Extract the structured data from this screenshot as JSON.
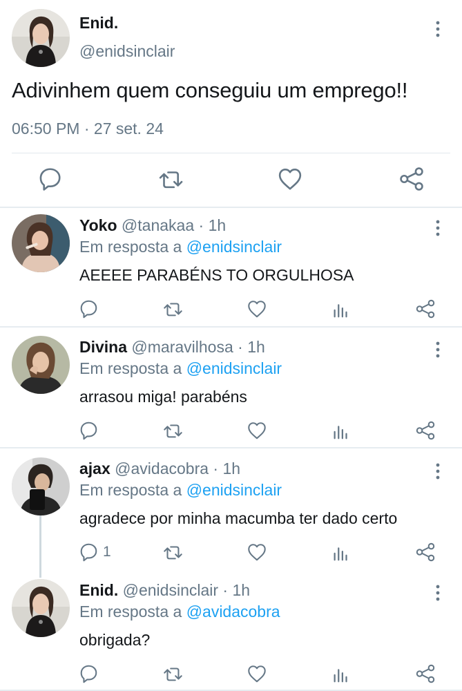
{
  "main": {
    "name": "Enid.",
    "handle": "@enidsinclair",
    "text": "Adivinhem quem conseguiu um emprego!!",
    "time": "06:50 PM",
    "date_sep": " · ",
    "date": "27 set. 24",
    "actions": [
      "reply-icon",
      "retweet-icon",
      "like-icon",
      "share-icon"
    ]
  },
  "replies": [
    {
      "name": "Yoko",
      "handle": "@tanakaa",
      "time": "1h",
      "reply_prefix": "Em resposta a ",
      "reply_to": "@enidsinclair",
      "text": "AEEEE PARABÉNS TO ORGULHOSA",
      "reply_count": ""
    },
    {
      "name": "Divina",
      "handle": "@maravilhosa",
      "time": "1h",
      "reply_prefix": "Em resposta a ",
      "reply_to": "@enidsinclair",
      "text": "arrasou miga! parabéns",
      "reply_count": ""
    },
    {
      "name": "ajax",
      "handle": "@avidacobra",
      "time": "1h",
      "reply_prefix": "Em resposta a ",
      "reply_to": "@enidsinclair",
      "text": "agradece por minha macumba ter dado certo",
      "reply_count": "1"
    },
    {
      "name": "Enid.",
      "handle": "@enidsinclair",
      "time": "1h",
      "reply_prefix": "Em resposta a ",
      "reply_to": "@avidacobra",
      "text": "obrigada?",
      "reply_count": ""
    }
  ],
  "separator_dot": " · ",
  "colors": {
    "accent": "#1da1f2",
    "muted": "#657786",
    "text": "#14171a",
    "divider": "#e6ecf0"
  }
}
